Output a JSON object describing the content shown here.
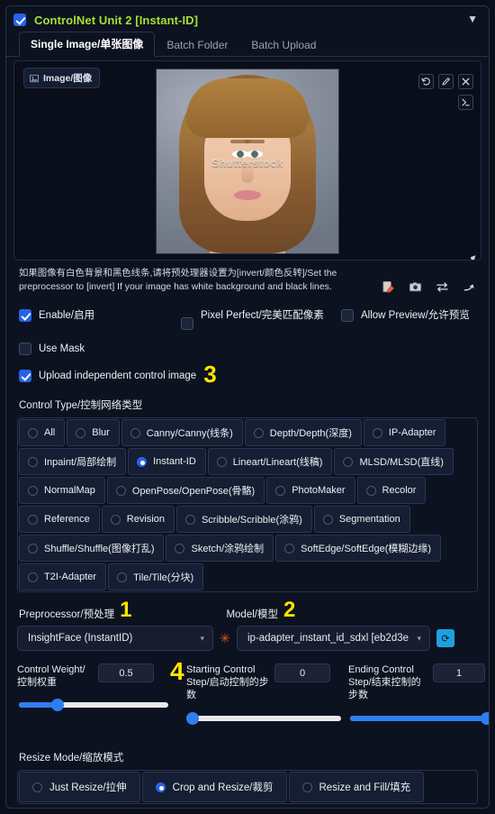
{
  "header": {
    "title": "ControlNet Unit 2 [Instant-ID]",
    "enabled": true,
    "collapse_icon": "▼",
    "accent_color": "#a6e22e"
  },
  "tabs": [
    {
      "label": "Single Image/单张图像",
      "active": true
    },
    {
      "label": "Batch Folder",
      "active": false
    },
    {
      "label": "Batch Upload",
      "active": false
    }
  ],
  "image_panel": {
    "tag_label": "Image/图像",
    "tag_icon": "image-icon",
    "watermark": "Shutterstock",
    "tools": [
      {
        "name": "undo-icon",
        "glyph": "↺"
      },
      {
        "name": "edit-pencil-icon",
        "glyph": "✎"
      },
      {
        "name": "close-icon",
        "glyph": "✕"
      }
    ],
    "tool_secondary": {
      "name": "open-editor-icon",
      "glyph": "⤢"
    }
  },
  "hint": {
    "text": "如果图像有白色背景和黑色线条,请将预处理器设置为[invert/颜色反转]/Set the preprocessor to [invert] If your image has white background and black lines.",
    "icons": [
      {
        "name": "new-canvas-icon",
        "glyph": "▱"
      },
      {
        "name": "webcam-icon",
        "glyph": "▣"
      },
      {
        "name": "swap-icon",
        "glyph": "⇄"
      },
      {
        "name": "send-to-icon",
        "glyph": "↱"
      }
    ]
  },
  "options": {
    "enable": {
      "label": "Enable/启用",
      "checked": true
    },
    "pixel_perfect": {
      "label": "Pixel Perfect/完美匹配像素",
      "checked": false
    },
    "allow_preview": {
      "label": "Allow Preview/允许预览",
      "checked": false
    },
    "use_mask": {
      "label": "Use Mask",
      "checked": false
    },
    "upload_independent": {
      "label": "Upload independent control image",
      "checked": true,
      "marker": "3"
    }
  },
  "control_type": {
    "label": "Control Type/控制网络类型",
    "selected": "Instant-ID",
    "rows": [
      [
        "All",
        "Blur",
        "Canny/Canny(线条)",
        "Depth/Depth(深度)",
        "IP-Adapter"
      ],
      [
        "Inpaint/局部绘制",
        "Instant-ID",
        "Lineart/Lineart(线稿)",
        "MLSD/MLSD(直线)"
      ],
      [
        "NormalMap",
        "OpenPose/OpenPose(骨骼)",
        "PhotoMaker",
        "Recolor"
      ],
      [
        "Reference",
        "Revision",
        "Scribble/Scribble(涂鸦)",
        "Segmentation"
      ],
      [
        "Shuffle/Shuffle(图像打乱)",
        "Sketch/涂鸦绘制",
        "SoftEdge/SoftEdge(模糊边缘)"
      ],
      [
        "T2I-Adapter",
        "Tile/Tile(分块)"
      ]
    ]
  },
  "preprocessor": {
    "label": "Preprocessor/预处理",
    "marker": "1",
    "value": "InsightFace (InstantID)",
    "caret": "▾"
  },
  "model": {
    "label": "Model/模型",
    "marker": "2",
    "value": "ip-adapter_instant_id_sdxl [eb2d3e",
    "caret": "▾",
    "refresh_icon": "refresh-icon",
    "refresh_glyph": "⟳"
  },
  "sliders": [
    {
      "name": "Control Weight/控制权重",
      "value": "0.5",
      "marker": "4",
      "fill_pct": 26,
      "fill_color": "#2f7ef0"
    },
    {
      "name": "Starting Control Step/启动控制的步数",
      "value": "0",
      "marker": "",
      "fill_pct": 2,
      "fill_color": "#2f7ef0"
    },
    {
      "name": "Ending Control Step/结束控制的步数",
      "value": "1",
      "marker": "",
      "fill_pct": 100,
      "fill_color": "#2f7ef0"
    }
  ],
  "resize_mode": {
    "label": "Resize Mode/缩放模式",
    "selected": "Crop and Resize/裁剪",
    "options": [
      "Just Resize/拉伸",
      "Crop and Resize/裁剪",
      "Resize and Fill/填充"
    ]
  }
}
